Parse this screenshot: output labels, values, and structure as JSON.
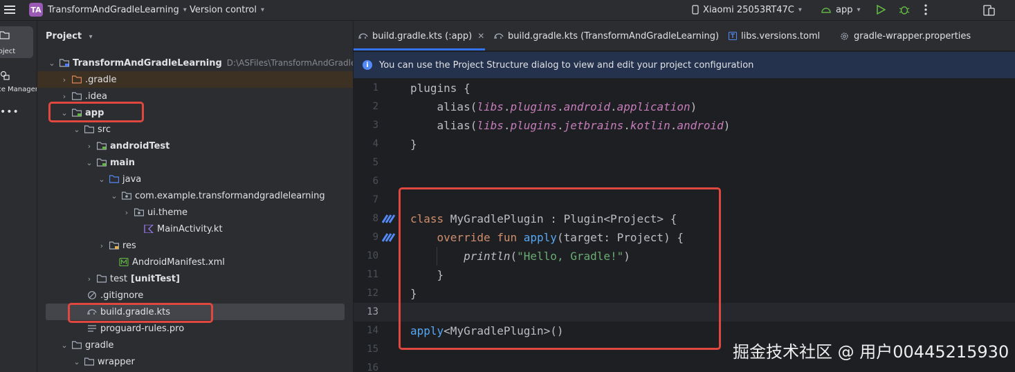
{
  "titlebar": {
    "project_badge": "TA",
    "project_name": "TransformAndGradleLearning",
    "vcs": "Version control",
    "device": "Xiaomi 25053RT47C",
    "run_config": "app"
  },
  "rail": {
    "project_label": "Project",
    "resource_label": "Resource Manager"
  },
  "project_panel": {
    "header": "Project",
    "tree": [
      {
        "label": "TransformAndGradleLearning",
        "path": "D:\\ASFiles\\TransformAndGradleLearn"
      },
      {
        "label": ".gradle"
      },
      {
        "label": ".idea"
      },
      {
        "label": "app"
      },
      {
        "label": "src"
      },
      {
        "label": "androidTest"
      },
      {
        "label": "main"
      },
      {
        "label": "java"
      },
      {
        "label": "com.example.transformandgradlelearning"
      },
      {
        "label": "ui.theme"
      },
      {
        "label": "MainActivity.kt"
      },
      {
        "label": "res"
      },
      {
        "label": "AndroidManifest.xml"
      },
      {
        "label": "test",
        "suffix": "[unitTest]"
      },
      {
        "label": ".gitignore"
      },
      {
        "label": "build.gradle.kts"
      },
      {
        "label": "proguard-rules.pro"
      },
      {
        "label": "gradle"
      },
      {
        "label": "wrapper"
      }
    ]
  },
  "editor": {
    "tabs": [
      {
        "label": "build.gradle.kts (:app)"
      },
      {
        "label": "build.gradle.kts (TransformAndGradleLearning)"
      },
      {
        "label": "libs.versions.toml"
      },
      {
        "label": "gradle-wrapper.properties"
      }
    ],
    "notice": "You can use the Project Structure dialog to view and edit your project configuration",
    "lines": [
      {
        "n": "1",
        "t": [
          "plugins {"
        ]
      },
      {
        "n": "2",
        "t": [
          "    alias(",
          "libs",
          ".",
          "plugins",
          ".",
          "android",
          ".",
          "application",
          ")"
        ]
      },
      {
        "n": "3",
        "t": [
          "    alias(",
          "libs",
          ".",
          "plugins",
          ".",
          "jetbrains",
          ".",
          "kotlin",
          ".",
          "android",
          ")"
        ]
      },
      {
        "n": "4",
        "t": [
          "}"
        ]
      },
      {
        "n": "5",
        "t": [
          ""
        ]
      },
      {
        "n": "6",
        "t": [
          ""
        ]
      },
      {
        "n": "7",
        "t": [
          ""
        ]
      },
      {
        "n": "8",
        "t": [
          "class",
          " MyGradlePlugin : Plugin<Project> {"
        ]
      },
      {
        "n": "9",
        "t": [
          "    ",
          "override fun",
          " ",
          "apply",
          "(target: Project) {"
        ]
      },
      {
        "n": "10",
        "t": [
          "        ",
          "println",
          "(",
          "\"Hello, Gradle!\"",
          ")"
        ]
      },
      {
        "n": "11",
        "t": [
          "    }"
        ]
      },
      {
        "n": "12",
        "t": [
          "}"
        ]
      },
      {
        "n": "13",
        "t": [
          ""
        ]
      },
      {
        "n": "14",
        "t": [
          "apply",
          "<MyGradlePlugin>()"
        ]
      },
      {
        "n": "15",
        "t": [
          ""
        ]
      },
      {
        "n": "16",
        "t": [
          ""
        ]
      }
    ]
  },
  "watermark": "掘金技术社区 @ 用户00445215930"
}
